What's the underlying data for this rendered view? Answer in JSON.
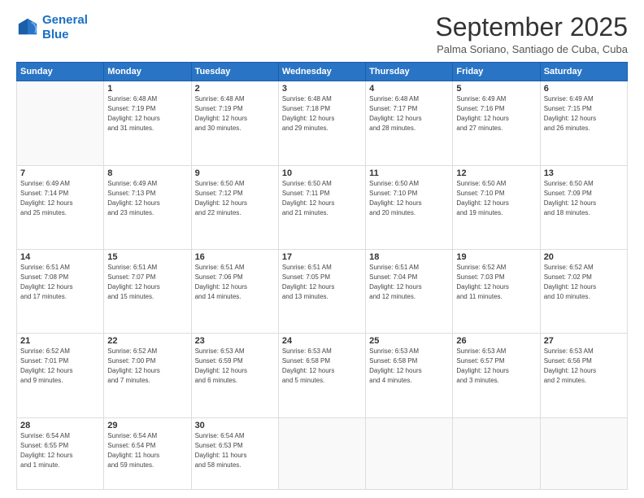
{
  "logo": {
    "line1": "General",
    "line2": "Blue"
  },
  "title": "September 2025",
  "subtitle": "Palma Soriano, Santiago de Cuba, Cuba",
  "days_header": [
    "Sunday",
    "Monday",
    "Tuesday",
    "Wednesday",
    "Thursday",
    "Friday",
    "Saturday"
  ],
  "weeks": [
    [
      {
        "num": "",
        "info": ""
      },
      {
        "num": "1",
        "info": "Sunrise: 6:48 AM\nSunset: 7:19 PM\nDaylight: 12 hours\nand 31 minutes."
      },
      {
        "num": "2",
        "info": "Sunrise: 6:48 AM\nSunset: 7:19 PM\nDaylight: 12 hours\nand 30 minutes."
      },
      {
        "num": "3",
        "info": "Sunrise: 6:48 AM\nSunset: 7:18 PM\nDaylight: 12 hours\nand 29 minutes."
      },
      {
        "num": "4",
        "info": "Sunrise: 6:48 AM\nSunset: 7:17 PM\nDaylight: 12 hours\nand 28 minutes."
      },
      {
        "num": "5",
        "info": "Sunrise: 6:49 AM\nSunset: 7:16 PM\nDaylight: 12 hours\nand 27 minutes."
      },
      {
        "num": "6",
        "info": "Sunrise: 6:49 AM\nSunset: 7:15 PM\nDaylight: 12 hours\nand 26 minutes."
      }
    ],
    [
      {
        "num": "7",
        "info": "Sunrise: 6:49 AM\nSunset: 7:14 PM\nDaylight: 12 hours\nand 25 minutes."
      },
      {
        "num": "8",
        "info": "Sunrise: 6:49 AM\nSunset: 7:13 PM\nDaylight: 12 hours\nand 23 minutes."
      },
      {
        "num": "9",
        "info": "Sunrise: 6:50 AM\nSunset: 7:12 PM\nDaylight: 12 hours\nand 22 minutes."
      },
      {
        "num": "10",
        "info": "Sunrise: 6:50 AM\nSunset: 7:11 PM\nDaylight: 12 hours\nand 21 minutes."
      },
      {
        "num": "11",
        "info": "Sunrise: 6:50 AM\nSunset: 7:10 PM\nDaylight: 12 hours\nand 20 minutes."
      },
      {
        "num": "12",
        "info": "Sunrise: 6:50 AM\nSunset: 7:10 PM\nDaylight: 12 hours\nand 19 minutes."
      },
      {
        "num": "13",
        "info": "Sunrise: 6:50 AM\nSunset: 7:09 PM\nDaylight: 12 hours\nand 18 minutes."
      }
    ],
    [
      {
        "num": "14",
        "info": "Sunrise: 6:51 AM\nSunset: 7:08 PM\nDaylight: 12 hours\nand 17 minutes."
      },
      {
        "num": "15",
        "info": "Sunrise: 6:51 AM\nSunset: 7:07 PM\nDaylight: 12 hours\nand 15 minutes."
      },
      {
        "num": "16",
        "info": "Sunrise: 6:51 AM\nSunset: 7:06 PM\nDaylight: 12 hours\nand 14 minutes."
      },
      {
        "num": "17",
        "info": "Sunrise: 6:51 AM\nSunset: 7:05 PM\nDaylight: 12 hours\nand 13 minutes."
      },
      {
        "num": "18",
        "info": "Sunrise: 6:51 AM\nSunset: 7:04 PM\nDaylight: 12 hours\nand 12 minutes."
      },
      {
        "num": "19",
        "info": "Sunrise: 6:52 AM\nSunset: 7:03 PM\nDaylight: 12 hours\nand 11 minutes."
      },
      {
        "num": "20",
        "info": "Sunrise: 6:52 AM\nSunset: 7:02 PM\nDaylight: 12 hours\nand 10 minutes."
      }
    ],
    [
      {
        "num": "21",
        "info": "Sunrise: 6:52 AM\nSunset: 7:01 PM\nDaylight: 12 hours\nand 9 minutes."
      },
      {
        "num": "22",
        "info": "Sunrise: 6:52 AM\nSunset: 7:00 PM\nDaylight: 12 hours\nand 7 minutes."
      },
      {
        "num": "23",
        "info": "Sunrise: 6:53 AM\nSunset: 6:59 PM\nDaylight: 12 hours\nand 6 minutes."
      },
      {
        "num": "24",
        "info": "Sunrise: 6:53 AM\nSunset: 6:58 PM\nDaylight: 12 hours\nand 5 minutes."
      },
      {
        "num": "25",
        "info": "Sunrise: 6:53 AM\nSunset: 6:58 PM\nDaylight: 12 hours\nand 4 minutes."
      },
      {
        "num": "26",
        "info": "Sunrise: 6:53 AM\nSunset: 6:57 PM\nDaylight: 12 hours\nand 3 minutes."
      },
      {
        "num": "27",
        "info": "Sunrise: 6:53 AM\nSunset: 6:56 PM\nDaylight: 12 hours\nand 2 minutes."
      }
    ],
    [
      {
        "num": "28",
        "info": "Sunrise: 6:54 AM\nSunset: 6:55 PM\nDaylight: 12 hours\nand 1 minute."
      },
      {
        "num": "29",
        "info": "Sunrise: 6:54 AM\nSunset: 6:54 PM\nDaylight: 11 hours\nand 59 minutes."
      },
      {
        "num": "30",
        "info": "Sunrise: 6:54 AM\nSunset: 6:53 PM\nDaylight: 11 hours\nand 58 minutes."
      },
      {
        "num": "",
        "info": ""
      },
      {
        "num": "",
        "info": ""
      },
      {
        "num": "",
        "info": ""
      },
      {
        "num": "",
        "info": ""
      }
    ]
  ]
}
